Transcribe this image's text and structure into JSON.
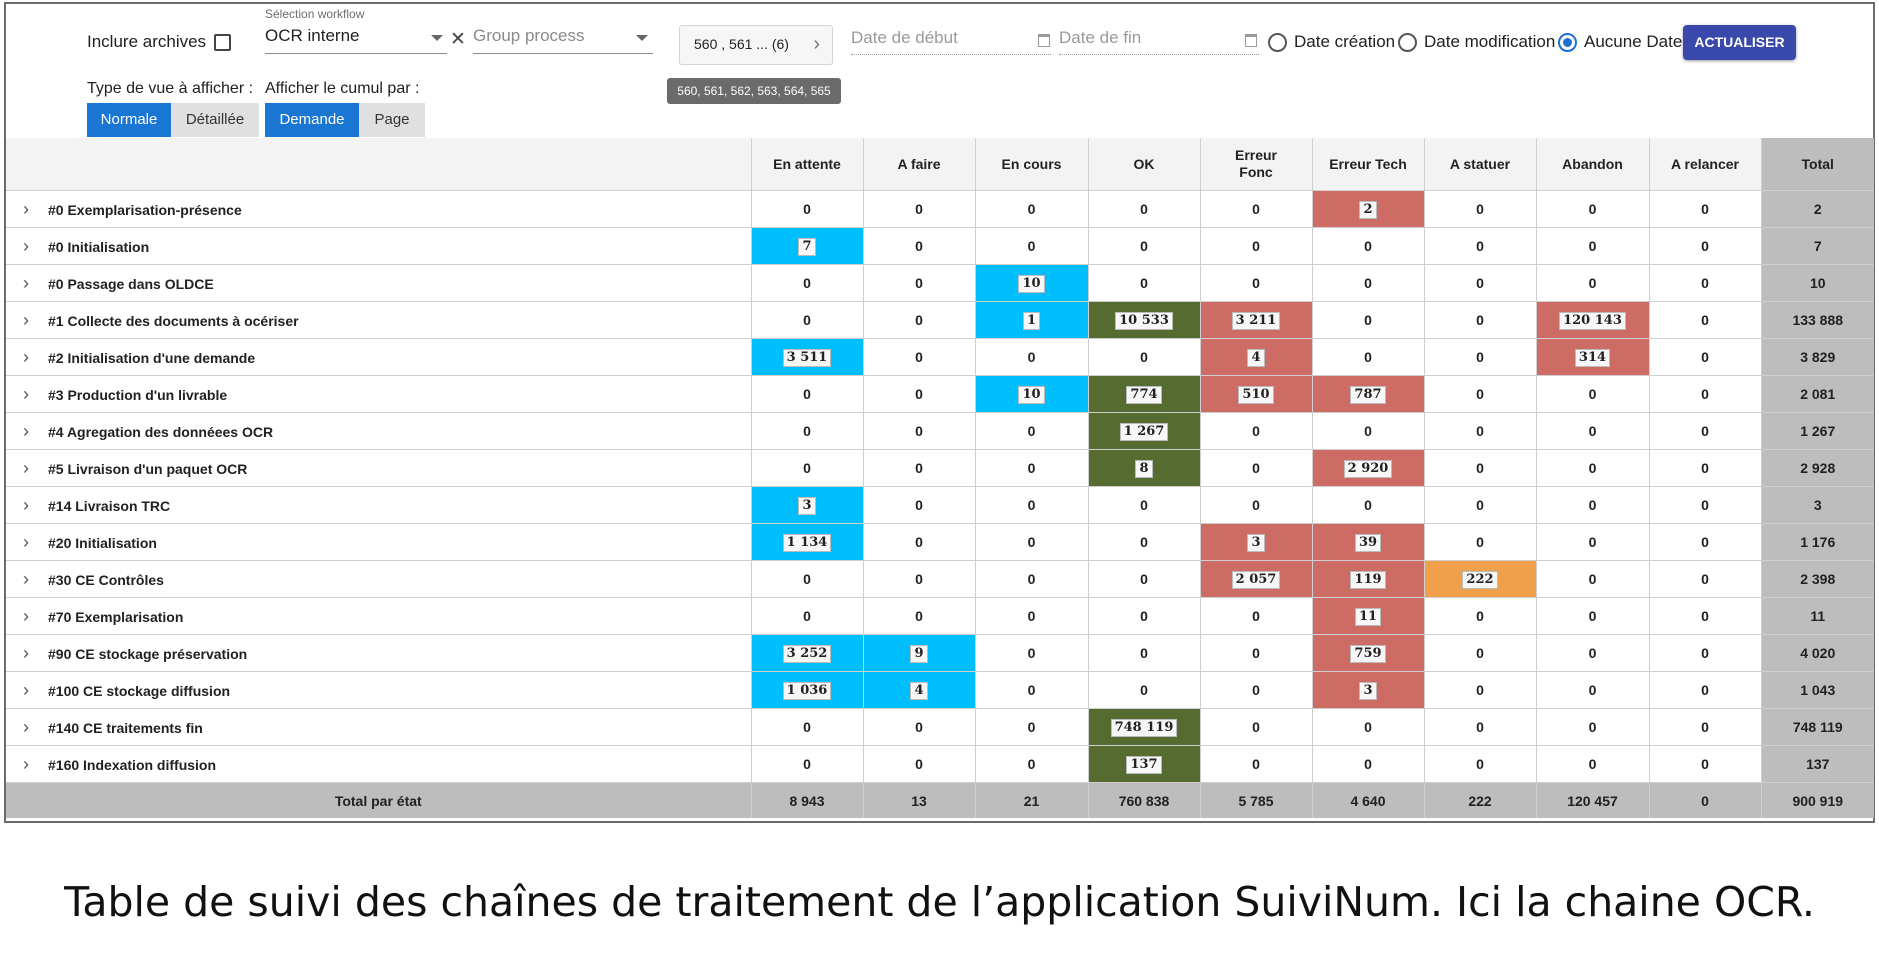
{
  "toolbar": {
    "include_archives": "Inclure archives",
    "workflow_label": "Sélection workflow",
    "workflow_value": "OCR interne",
    "group_process_placeholder": "Group process",
    "ids_chip": "560 , 561 ... (6)",
    "ids_tooltip": "560, 561, 562, 563, 564, 565",
    "date_start_placeholder": "Date de début",
    "date_end_placeholder": "Date de fin",
    "radio_creation": "Date création",
    "radio_modification": "Date modification",
    "radio_none": "Aucune Date",
    "selected_radio": "Aucune Date",
    "refresh": "ACTUALISER",
    "view_type_label": "Type de vue à afficher :",
    "view_normal": "Normale",
    "view_detailed": "Détaillée",
    "cumul_label": "Afficher le cumul par :",
    "cumul_request": "Demande",
    "cumul_page": "Page"
  },
  "table": {
    "columns": [
      "En attente",
      "A faire",
      "En cours",
      "OK",
      "Erreur\nFonc",
      "Erreur Tech",
      "A statuer",
      "Abandon",
      "A relancer",
      "Total"
    ],
    "rows": [
      {
        "name": "#0 Exemplarisation-présence",
        "cells": [
          "0",
          "0",
          "0",
          "0",
          "0",
          "2",
          "0",
          "0",
          "0"
        ],
        "colors": [
          "",
          "",
          "",
          "",
          "",
          "red",
          "",
          "",
          ""
        ],
        "total": "2"
      },
      {
        "name": "#0 Initialisation",
        "cells": [
          "7",
          "0",
          "0",
          "0",
          "0",
          "0",
          "0",
          "0",
          "0"
        ],
        "colors": [
          "blue",
          "",
          "",
          "",
          "",
          "",
          "",
          "",
          ""
        ],
        "total": "7"
      },
      {
        "name": "#0 Passage dans OLDCE",
        "cells": [
          "0",
          "0",
          "10",
          "0",
          "0",
          "0",
          "0",
          "0",
          "0"
        ],
        "colors": [
          "",
          "",
          "blue",
          "",
          "",
          "",
          "",
          "",
          ""
        ],
        "total": "10"
      },
      {
        "name": "#1 Collecte des documents à océriser",
        "cells": [
          "0",
          "0",
          "1",
          "10 533",
          "3 211",
          "0",
          "0",
          "120 143",
          "0"
        ],
        "colors": [
          "",
          "",
          "blue",
          "green",
          "red",
          "",
          "",
          "red",
          ""
        ],
        "total": "133 888"
      },
      {
        "name": "#2 Initialisation d'une demande",
        "cells": [
          "3 511",
          "0",
          "0",
          "0",
          "4",
          "0",
          "0",
          "314",
          "0"
        ],
        "colors": [
          "blue",
          "",
          "",
          "",
          "red",
          "",
          "",
          "red",
          ""
        ],
        "total": "3 829"
      },
      {
        "name": "#3 Production d'un livrable",
        "cells": [
          "0",
          "0",
          "10",
          "774",
          "510",
          "787",
          "0",
          "0",
          "0"
        ],
        "colors": [
          "",
          "",
          "blue",
          "green",
          "red",
          "red",
          "",
          "",
          ""
        ],
        "total": "2 081"
      },
      {
        "name": "#4 Agregation des donnéees OCR",
        "cells": [
          "0",
          "0",
          "0",
          "1 267",
          "0",
          "0",
          "0",
          "0",
          "0"
        ],
        "colors": [
          "",
          "",
          "",
          "green",
          "",
          "",
          "",
          "",
          ""
        ],
        "total": "1 267"
      },
      {
        "name": "#5 Livraison d'un paquet OCR",
        "cells": [
          "0",
          "0",
          "0",
          "8",
          "0",
          "2 920",
          "0",
          "0",
          "0"
        ],
        "colors": [
          "",
          "",
          "",
          "green",
          "",
          "red",
          "",
          "",
          ""
        ],
        "total": "2 928"
      },
      {
        "name": "#14 Livraison TRC",
        "cells": [
          "3",
          "0",
          "0",
          "0",
          "0",
          "0",
          "0",
          "0",
          "0"
        ],
        "colors": [
          "blue",
          "",
          "",
          "",
          "",
          "",
          "",
          "",
          ""
        ],
        "total": "3"
      },
      {
        "name": "#20 Initialisation",
        "cells": [
          "1 134",
          "0",
          "0",
          "0",
          "3",
          "39",
          "0",
          "0",
          "0"
        ],
        "colors": [
          "blue",
          "",
          "",
          "",
          "red",
          "red",
          "",
          "",
          ""
        ],
        "total": "1 176"
      },
      {
        "name": "#30 CE Contrôles",
        "cells": [
          "0",
          "0",
          "0",
          "0",
          "2 057",
          "119",
          "222",
          "0",
          "0"
        ],
        "colors": [
          "",
          "",
          "",
          "",
          "red",
          "red",
          "orange",
          "",
          ""
        ],
        "total": "2 398"
      },
      {
        "name": "#70 Exemplarisation",
        "cells": [
          "0",
          "0",
          "0",
          "0",
          "0",
          "11",
          "0",
          "0",
          "0"
        ],
        "colors": [
          "",
          "",
          "",
          "",
          "",
          "red",
          "",
          "",
          ""
        ],
        "total": "11"
      },
      {
        "name": "#90 CE stockage préservation",
        "cells": [
          "3 252",
          "9",
          "0",
          "0",
          "0",
          "759",
          "0",
          "0",
          "0"
        ],
        "colors": [
          "blue",
          "blue",
          "",
          "",
          "",
          "red",
          "",
          "",
          ""
        ],
        "total": "4 020"
      },
      {
        "name": "#100 CE stockage diffusion",
        "cells": [
          "1 036",
          "4",
          "0",
          "0",
          "0",
          "3",
          "0",
          "0",
          "0"
        ],
        "colors": [
          "blue",
          "blue",
          "",
          "",
          "",
          "red",
          "",
          "",
          ""
        ],
        "total": "1 043"
      },
      {
        "name": "#140 CE traitements fin",
        "cells": [
          "0",
          "0",
          "0",
          "748 119",
          "0",
          "0",
          "0",
          "0",
          "0"
        ],
        "colors": [
          "",
          "",
          "",
          "green",
          "",
          "",
          "",
          "",
          ""
        ],
        "total": "748 119"
      },
      {
        "name": "#160 Indexation diffusion",
        "cells": [
          "0",
          "0",
          "0",
          "137",
          "0",
          "0",
          "0",
          "0",
          "0"
        ],
        "colors": [
          "",
          "",
          "",
          "green",
          "",
          "",
          "",
          "",
          ""
        ],
        "total": "137"
      }
    ],
    "footer": {
      "label": "Total par état",
      "cells": [
        "8 943",
        "13",
        "21",
        "760 838",
        "5 785",
        "4 640",
        "222",
        "120 457",
        "0"
      ],
      "total": "900 919"
    }
  },
  "colors": {
    "blue": "#00bfff",
    "green": "#556b2f",
    "red": "#cd6b65",
    "orange": "#f0a04b",
    "accent": "#3949ab"
  },
  "caption": "Table de suivi des chaînes de traitement de l’application SuiviNum. Ici la chaine OCR."
}
